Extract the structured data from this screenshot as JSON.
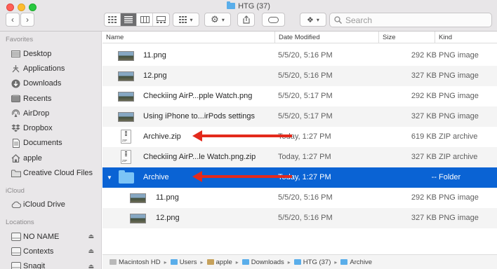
{
  "window": {
    "title": "HTG (37)"
  },
  "toolbar": {
    "back_icon": "chevron-left-icon",
    "forward_icon": "chevron-right-icon",
    "search_placeholder": "Search"
  },
  "sidebar": {
    "favorites_label": "Favorites",
    "favorites": [
      {
        "label": "Desktop",
        "icon": "desktop-icon"
      },
      {
        "label": "Applications",
        "icon": "applications-icon"
      },
      {
        "label": "Downloads",
        "icon": "downloads-icon"
      },
      {
        "label": "Recents",
        "icon": "recents-icon"
      },
      {
        "label": "AirDrop",
        "icon": "airdrop-icon"
      },
      {
        "label": "Dropbox",
        "icon": "dropbox-icon"
      },
      {
        "label": "Documents",
        "icon": "documents-icon"
      },
      {
        "label": "apple",
        "icon": "home-icon"
      },
      {
        "label": "Creative Cloud Files",
        "icon": "folder-icon"
      }
    ],
    "icloud_label": "iCloud",
    "icloud": [
      {
        "label": "iCloud Drive",
        "icon": "cloud-icon"
      }
    ],
    "locations_label": "Locations",
    "locations": [
      {
        "label": "NO NAME",
        "icon": "drive-icon"
      },
      {
        "label": "Contexts",
        "icon": "drive-icon"
      },
      {
        "label": "Snagit",
        "icon": "drive-icon"
      }
    ]
  },
  "columns": {
    "name": "Name",
    "date": "Date Modified",
    "size": "Size",
    "kind": "Kind"
  },
  "files": [
    {
      "name": "11.png",
      "date": "5/5/20, 5:16 PM",
      "size": "292 KB",
      "kind": "PNG image"
    },
    {
      "name": "12.png",
      "date": "5/5/20, 5:16 PM",
      "size": "327 KB",
      "kind": "PNG image"
    },
    {
      "name": "Checkiing AirP...pple Watch.png",
      "date": "5/5/20, 5:17 PM",
      "size": "292 KB",
      "kind": "PNG image"
    },
    {
      "name": "Using iPhone to...irPods settings",
      "date": "5/5/20, 5:17 PM",
      "size": "327 KB",
      "kind": "PNG image"
    },
    {
      "name": "Archive.zip",
      "date": "Today, 1:27 PM",
      "size": "619 KB",
      "kind": "ZIP archive"
    },
    {
      "name": "Checkiing AirP...le Watch.png.zip",
      "date": "Today, 1:27 PM",
      "size": "327 KB",
      "kind": "ZIP archive"
    },
    {
      "name": "Archive",
      "date": "Today, 1:27 PM",
      "size": "--",
      "kind": "Folder"
    },
    {
      "name": "11.png",
      "date": "5/5/20, 5:16 PM",
      "size": "292 KB",
      "kind": "PNG image"
    },
    {
      "name": "12.png",
      "date": "5/5/20, 5:16 PM",
      "size": "327 KB",
      "kind": "PNG image"
    }
  ],
  "path": [
    "Macintosh HD",
    "Users",
    "apple",
    "Downloads",
    "HTG (37)",
    "Archive"
  ],
  "colors": {
    "selection": "#0a63d4",
    "arrow": "#e32a1c",
    "folder": "#7cc4f6"
  }
}
